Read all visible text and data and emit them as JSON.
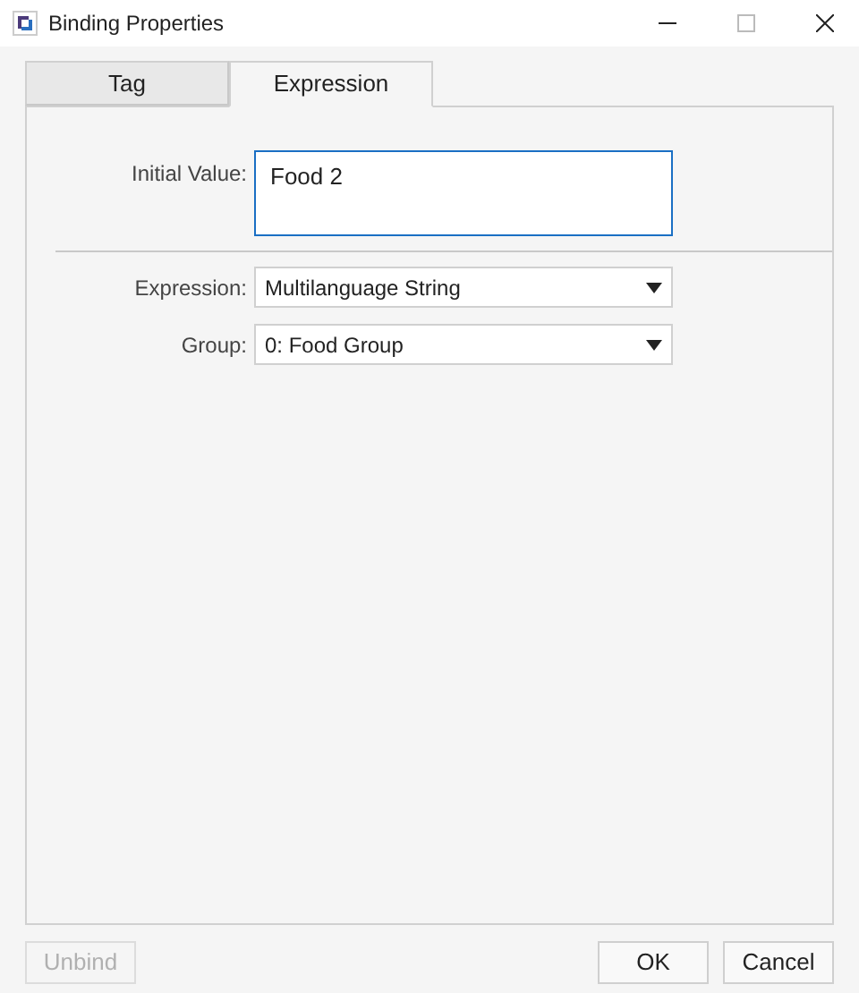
{
  "window": {
    "title": "Binding Properties"
  },
  "tabs": [
    {
      "label": "Tag",
      "selected": false
    },
    {
      "label": "Expression",
      "selected": true
    }
  ],
  "initial_value": {
    "label": "Initial Value:",
    "value": "Food 2"
  },
  "fields": [
    {
      "label": "Expression:",
      "value": "Multilanguage String"
    },
    {
      "label": "Group:",
      "value": "0: Food Group"
    }
  ],
  "left_buttons": [
    {
      "label": "Unbind",
      "disabled": true
    }
  ],
  "buttons": [
    {
      "label": "OK",
      "disabled": false
    },
    {
      "label": "Cancel",
      "disabled": false
    }
  ]
}
